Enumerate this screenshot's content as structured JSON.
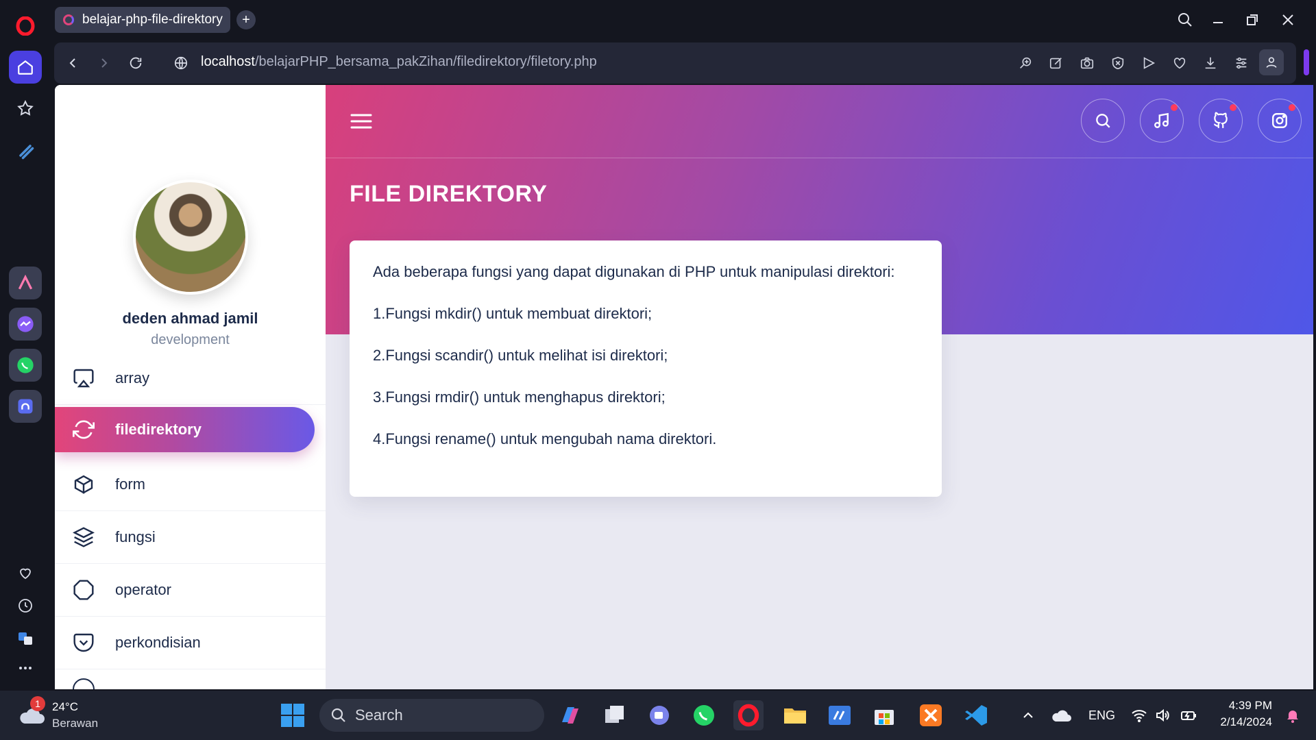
{
  "browser": {
    "tab_title": "belajar-php-file-direktory",
    "url_host": "localhost",
    "url_path": "/belajarPHP_bersama_pakZihan/filedirektory/filetory.php"
  },
  "sidebar_user": {
    "name": "deden ahmad jamil",
    "role": "development"
  },
  "menu": [
    {
      "label": "array",
      "icon": "airplay-icon"
    },
    {
      "label": "filedirektory",
      "icon": "refresh-icon",
      "active": true
    },
    {
      "label": "form",
      "icon": "box-icon"
    },
    {
      "label": "fungsi",
      "icon": "layers-icon"
    },
    {
      "label": "operator",
      "icon": "octagon-icon"
    },
    {
      "label": "perkondisian",
      "icon": "pocket-icon"
    }
  ],
  "page": {
    "title": "FILE DIREKTORY",
    "intro": "Ada beberapa fungsi yang dapat digunakan di PHP untuk manipulasi direktori:",
    "items": [
      "1.Fungsi mkdir() untuk membuat direktori;",
      "2.Fungsi scandir() untuk melihat isi direktori;",
      "3.Fungsi rmdir() untuk menghapus direktori;",
      "4.Fungsi rename() untuk mengubah nama direktori."
    ]
  },
  "taskbar": {
    "weather_temp": "24°C",
    "weather_desc": "Berawan",
    "weather_badge": "1",
    "search_placeholder": "Search",
    "lang": "ENG",
    "time": "4:39 PM",
    "date": "2/14/2024"
  },
  "colors": {
    "accent_pink": "#e2457a",
    "accent_blue": "#4f57e8",
    "text_dark": "#1d2b4a"
  }
}
